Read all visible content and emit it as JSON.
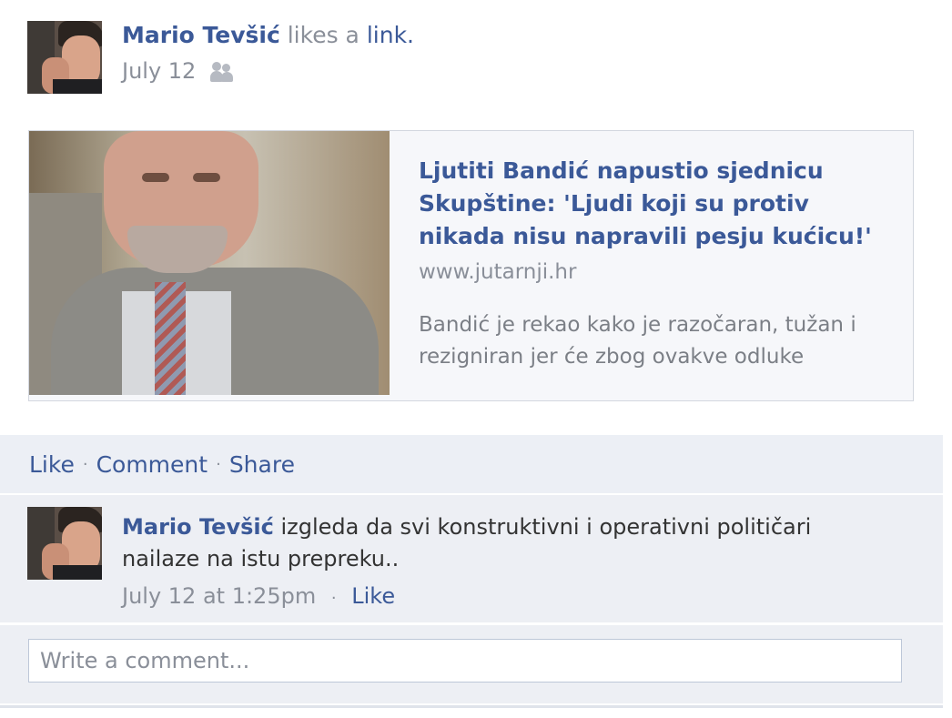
{
  "story": {
    "author": "Mario Tevšić",
    "action": " likes a ",
    "object": "link.",
    "date": "July 12"
  },
  "shared_link": {
    "title": "Ljutiti Bandić napustio sjednicu Skupštine: 'Ljudi koji su protiv nikada nisu napravili pesju kućicu!'",
    "domain": "www.jutarnji.hr",
    "summary": "Bandić je rekao kako je razočaran, tužan i rezigniran jer će zbog ovakve odluke"
  },
  "actions": {
    "like": "Like",
    "comment": "Comment",
    "share": "Share",
    "separator": "·"
  },
  "comment": {
    "author": "Mario Tevšić",
    "text": " izgleda da svi konstruktivni i operativni političari nailaze na istu prepreku..",
    "timestamp": "July 12 at 1:25pm",
    "separator": "·",
    "like": "Like"
  },
  "composer": {
    "placeholder": "Write a comment..."
  },
  "colors": {
    "link": "#3b5998",
    "meta": "#8a8f99",
    "panel": "#edeff4"
  }
}
